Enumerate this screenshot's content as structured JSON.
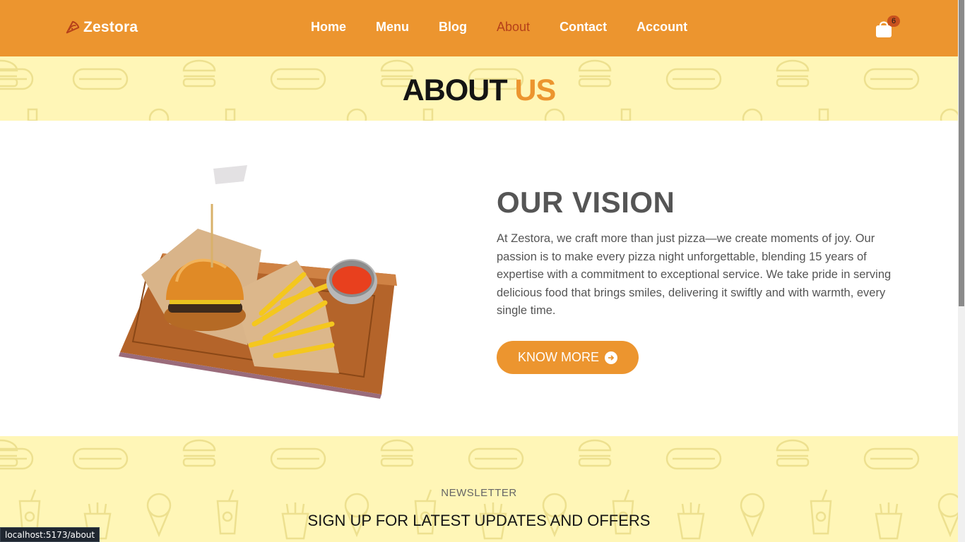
{
  "header": {
    "brand": "Zestora",
    "nav": [
      {
        "label": "Home",
        "active": false
      },
      {
        "label": "Menu",
        "active": false
      },
      {
        "label": "Blog",
        "active": false
      },
      {
        "label": "About",
        "active": true
      },
      {
        "label": "Contact",
        "active": false
      },
      {
        "label": "Account",
        "active": false
      }
    ],
    "cart_count": "6",
    "cart_icon": "shopping-bag-icon"
  },
  "title": {
    "part1": "ABOUT",
    "part2": "US"
  },
  "vision": {
    "heading": "OUR VISION",
    "body": "At Zestora, we craft more than just pizza—we create moments of joy. Our passion is to make every pizza night unforgettable, blending 15 years of expertise with a commitment to exceptional service. We take pride in serving delicious food that brings smiles, delivering it swiftly and with warmth, every single time.",
    "button_label": "KNOW MORE",
    "image": "burger-and-fries-on-board"
  },
  "newsletter": {
    "label": "NEWSLETTER",
    "heading": "SIGN UP FOR LATEST UPDATES AND OFFERS"
  },
  "status_url": "localhost:5173/about",
  "colors": {
    "accent": "#ec952f",
    "active_nav": "#b5401a",
    "pattern_bg": "#fff6b7",
    "text_dark": "#141414",
    "text_gray": "#555555"
  }
}
